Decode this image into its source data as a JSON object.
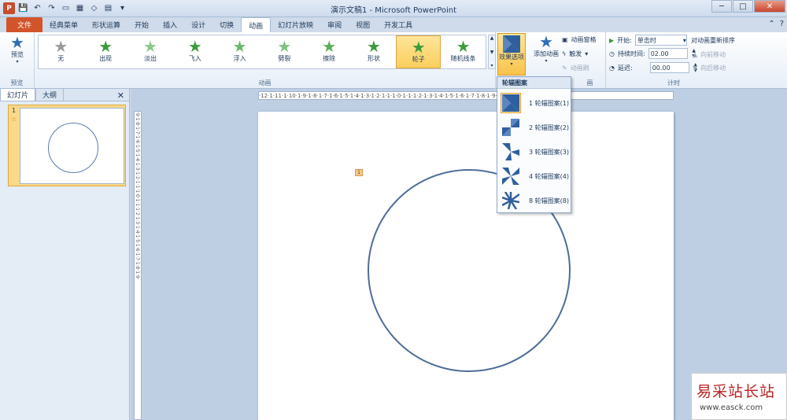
{
  "window": {
    "title": "演示文稿1 - Microsoft PowerPoint"
  },
  "tabs": [
    "文件",
    "经典菜单",
    "形状运算",
    "开始",
    "插入",
    "设计",
    "切换",
    "动画",
    "幻灯片放映",
    "审阅",
    "视图",
    "开发工具"
  ],
  "preview": {
    "label": "预览",
    "group": "预览"
  },
  "animations": {
    "group": "动画",
    "items": [
      {
        "label": "无"
      },
      {
        "label": "出现"
      },
      {
        "label": "淡出"
      },
      {
        "label": "飞入"
      },
      {
        "label": "浮入"
      },
      {
        "label": "劈裂"
      },
      {
        "label": "擦除"
      },
      {
        "label": "形状"
      },
      {
        "label": "轮子"
      },
      {
        "label": "随机线条"
      }
    ],
    "selected": "轮子"
  },
  "effect_options": {
    "label": "效果选项"
  },
  "advanced": {
    "add_animation": "添加动画",
    "animation_pane": "动画窗格",
    "trigger": "触发",
    "painter": "动画刷",
    "group_suffix": "画"
  },
  "timing": {
    "group": "计时",
    "start_label": "开始:",
    "start_value": "单击时",
    "duration_label": "持续时间:",
    "duration_value": "02.00",
    "delay_label": "延迟:",
    "delay_value": "00.00",
    "reorder": "对动画重新排序",
    "move_earlier": "向前移动",
    "move_later": "向后移动"
  },
  "panel": {
    "tab_slides": "幻灯片",
    "tab_outline": "大纲",
    "slide_number": "1"
  },
  "ruler": {
    "horizontal": "·12·1·11·1·10·1·9·1·8·1·7·1·6·1·5·1·4·1·3·1·2·1·1·1·0·1·1·1·2·1·3·1·4·1·5·1·6·1·7·1·8·1·9·1·10·1·11·1·12·",
    "vertical": "·9·1·8·1·7·1·6·1·5·1·4·1·3·1·2·1·1·1·0·1·1·1·2·1·3·1·4·1·5·1·6·1·7·1·8·1·9·"
  },
  "slide": {
    "anim_tag": "1"
  },
  "dropdown": {
    "title": "轮辐图案",
    "items": [
      "1 轮辐图案(1)",
      "2 轮辐图案(2)",
      "3 轮辐图案(3)",
      "4 轮辐图案(4)",
      "8 轮辐图案(8)"
    ]
  },
  "watermark": {
    "line1": "易采站长站",
    "line2": "www.easck.com"
  }
}
